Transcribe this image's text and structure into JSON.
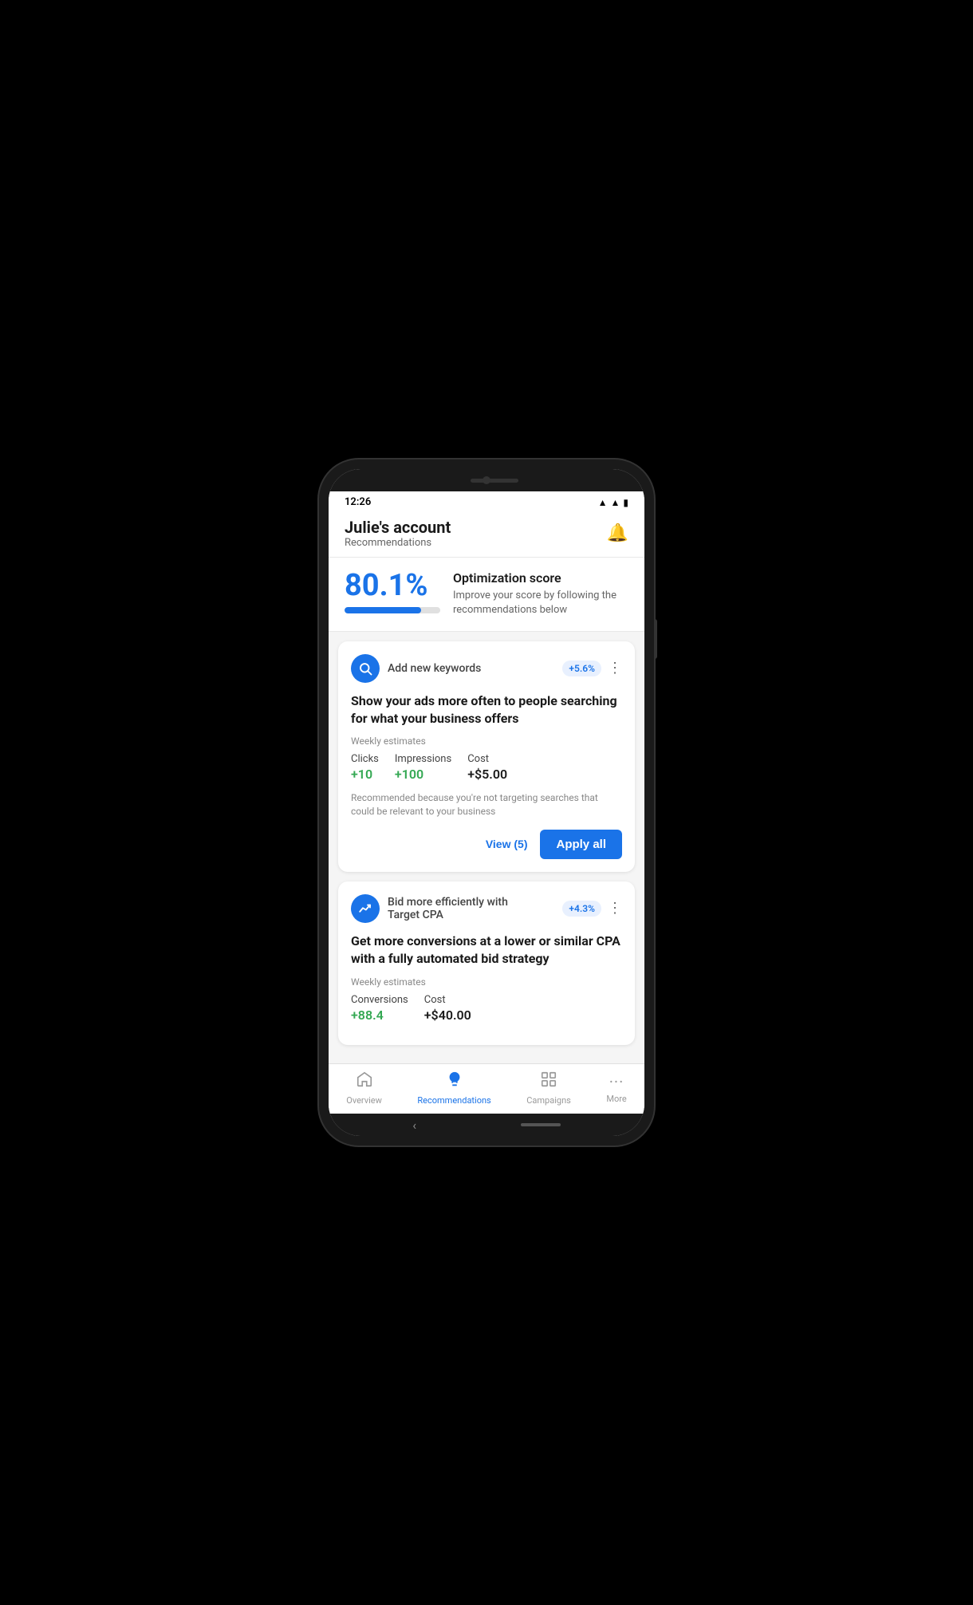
{
  "status": {
    "time": "12:26"
  },
  "header": {
    "account_name": "Julie's account",
    "subtitle": "Recommendations"
  },
  "optimization": {
    "score": "80.1%",
    "title": "Optimization score",
    "description": "Improve your score by following the recommendations below",
    "progress": 80.1
  },
  "cards": [
    {
      "id": "card1",
      "icon": "🔍",
      "title": "Add new keywords",
      "score_badge": "+5.6%",
      "main_title": "Show your ads more often to people searching for what your business offers",
      "weekly_label": "Weekly estimates",
      "stats": [
        {
          "label": "Clicks",
          "value": "+10",
          "type": "positive"
        },
        {
          "label": "Impressions",
          "value": "+100",
          "type": "positive"
        },
        {
          "label": "Cost",
          "value": "+$5.00",
          "type": "neutral"
        }
      ],
      "reason": "Recommended because you're not targeting searches that could be relevant to your business",
      "view_btn": "View (5)",
      "apply_btn": "Apply all"
    },
    {
      "id": "card2",
      "icon": "📈",
      "title": "Bid more efficiently with\nTarget CPA",
      "score_badge": "+4.3%",
      "main_title": "Get more conversions at a lower or similar CPA with a fully automated bid strategy",
      "weekly_label": "Weekly estimates",
      "stats": [
        {
          "label": "Conversions",
          "value": "+88.4",
          "type": "positive"
        },
        {
          "label": "Cost",
          "value": "+$40.00",
          "type": "neutral"
        }
      ],
      "reason": "",
      "view_btn": "",
      "apply_btn": ""
    }
  ],
  "nav": {
    "items": [
      {
        "label": "Overview",
        "icon": "🏠",
        "active": false
      },
      {
        "label": "Recommendations",
        "icon": "💡",
        "active": true
      },
      {
        "label": "Campaigns",
        "icon": "📊",
        "active": false
      },
      {
        "label": "More",
        "icon": "···",
        "active": false
      }
    ]
  }
}
